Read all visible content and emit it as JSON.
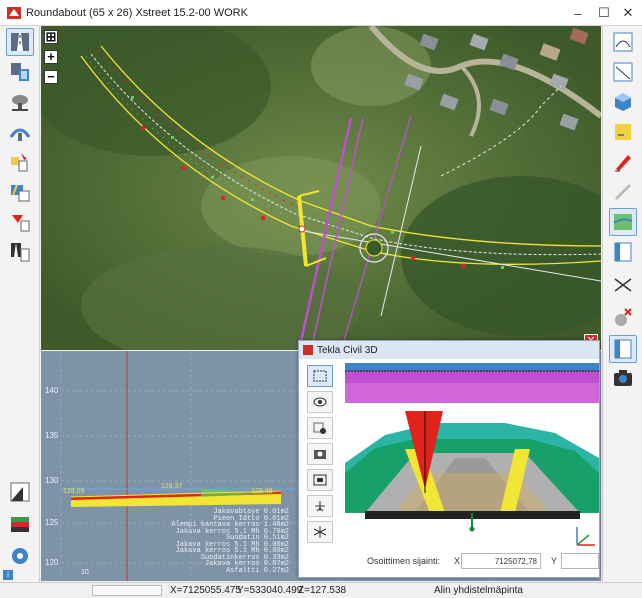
{
  "window": {
    "title": "Roundabout  (65 x 26)   Xstreet 15.2-00 WORK",
    "minimize": "–",
    "maximize": "☐",
    "close": "✕"
  },
  "map": {
    "zoom_in": "+",
    "zoom_out": "−",
    "zoom_extents": "⊞"
  },
  "profile": {
    "y_ticks": [
      "140",
      "135",
      "130",
      "125",
      "120"
    ],
    "left_value": "128.09",
    "mid_value": "128.37",
    "right_value": "129.48",
    "x_tick": "10",
    "layer_lines": [
      "Jakavabtaye 0.01m2",
      "Pieen Idtto 0.01m2",
      "Alempi kantava kerros 1.46m2",
      "Jakava kerros 5.1 Mh 6.70m2",
      "Suodatin 0.51m2",
      "Jakava kerros 5.1 Mh 0.00m2",
      "Jakava kerros 5.1 Mh 0.80m2",
      "Suodatinkerros 0.33m2",
      "Jakava kerros 0.87m2",
      "Asfaltti 0.27m2"
    ]
  },
  "dialog": {
    "title": "Tekla Civil 3D",
    "close": "✕",
    "coord_label": "Osoittimen sijainti:",
    "x_label": "X",
    "x_value": "7125072,78",
    "y_label": "Y"
  },
  "status": {
    "x": "X=7125055.475",
    "y": "Y=533040.499",
    "z": "Z=127.538",
    "layer": "Alin yhdistelmäpinta"
  },
  "colors": {
    "accent": "#2b6cc4",
    "selection": "#dbe9f8",
    "alignment_magenta": "#c04fd0",
    "edge_yellow": "#f2e634",
    "marker_red": "#e0231c"
  }
}
